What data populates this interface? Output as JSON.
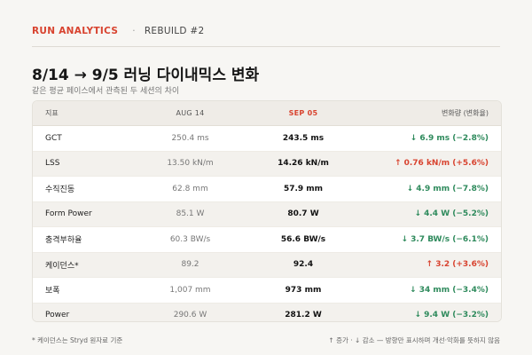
{
  "header": {
    "brand": "RUN ANALYTICS",
    "separator": "·",
    "crumb": "REBUILD #2"
  },
  "title": "8/14 → 9/5 러닝 다이내믹스 변화",
  "subtitle": "같은 평균 페이스에서 관측된 두 세션의 차이",
  "table": {
    "headers": [
      "지표",
      "AUG 14",
      "SEP 05",
      "변화량 (변화율)"
    ],
    "rows": [
      {
        "metric": "GCT",
        "aug": "250.4 ms",
        "sep": "243.5 ms",
        "change": "↓ 6.9 ms (−2.8%)",
        "dir": "down"
      },
      {
        "metric": "LSS",
        "aug": "13.50 kN/m",
        "sep": "14.26 kN/m",
        "change": "↑ 0.76 kN/m (+5.6%)",
        "dir": "up"
      },
      {
        "metric": "수직진동",
        "aug": "62.8 mm",
        "sep": "57.9 mm",
        "change": "↓ 4.9 mm (−7.8%)",
        "dir": "down"
      },
      {
        "metric": "Form Power",
        "aug": "85.1 W",
        "sep": "80.7 W",
        "change": "↓ 4.4 W (−5.2%)",
        "dir": "down"
      },
      {
        "metric": "충격부하율",
        "aug": "60.3 BW/s",
        "sep": "56.6 BW/s",
        "change": "↓ 3.7 BW/s (−6.1%)",
        "dir": "down"
      },
      {
        "metric": "케이던스*",
        "aug": "89.2",
        "sep": "92.4",
        "change": "↑ 3.2 (+3.6%)",
        "dir": "up"
      },
      {
        "metric": "보폭",
        "aug": "1,007 mm",
        "sep": "973 mm",
        "change": "↓ 34 mm (−3.4%)",
        "dir": "down"
      },
      {
        "metric": "Power",
        "aug": "290.6 W",
        "sep": "281.2 W",
        "change": "↓ 9.4 W (−3.2%)",
        "dir": "down"
      }
    ]
  },
  "footer": {
    "note": "* 케이던스는 Stryd 원자료 기준",
    "legend": "↑ 증가 · ↓ 감소 — 방향만 표시하며 개선·악화를 뜻하지 않음"
  },
  "colors": {
    "accent": "#d8432f",
    "decrease": "#2e8a5c",
    "increase": "#d8432f"
  }
}
